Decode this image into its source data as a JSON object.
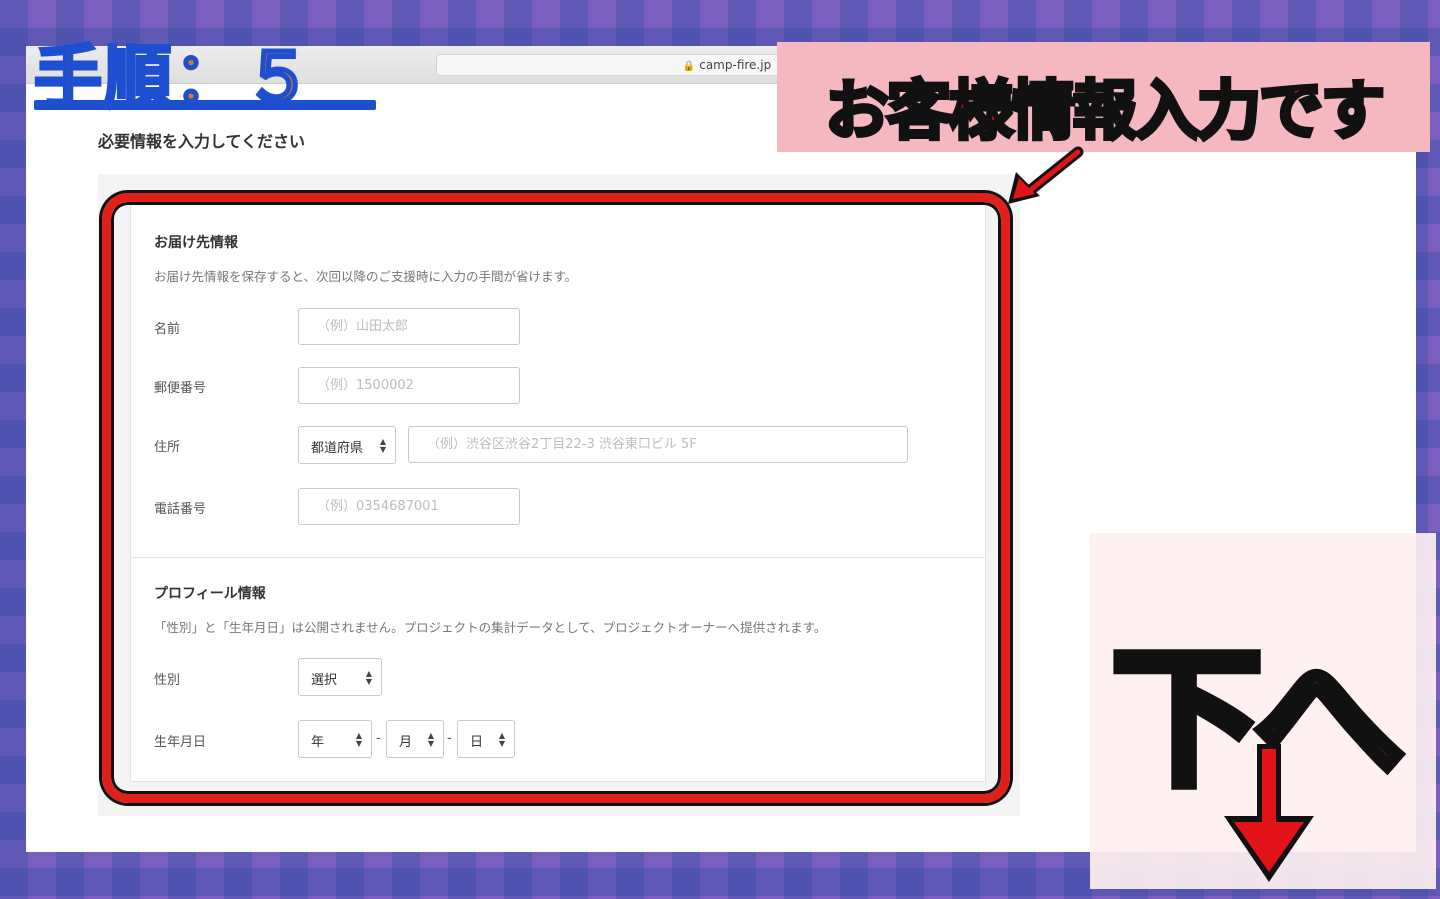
{
  "browser": {
    "url": "camp-fire.jp"
  },
  "page": {
    "heading": "必要情報を入力してください"
  },
  "delivery": {
    "title": "お届け先情報",
    "note": "お届け先情報を保存すると、次回以降のご支援時に入力の手間が省けます。",
    "name_label": "名前",
    "name_placeholder": "（例）山田太郎",
    "postal_label": "郵便番号",
    "postal_placeholder": "（例）1500002",
    "address_label": "住所",
    "prefecture_select": "都道府県",
    "address_placeholder": "（例）渋谷区渋谷2丁目22-3 渋谷東口ビル 5F",
    "phone_label": "電話番号",
    "phone_placeholder": "（例）0354687001"
  },
  "profile": {
    "title": "プロフィール情報",
    "note": "「性別」と「生年月日」は公開されません。プロジェクトの集計データとして、プロジェクトオーナーへ提供されます。",
    "gender_label": "性別",
    "gender_select": "選択",
    "birthdate_label": "生年月日",
    "year_select": "年",
    "month_select": "月",
    "day_select": "日",
    "separator": "-"
  },
  "overlay": {
    "step": "手順：５",
    "banner": "お客様情報入力です",
    "next": "下へ",
    "colors": {
      "accent_red": "#e3131a",
      "step_orange": "#d9781f",
      "step_blue": "#1e4fd0",
      "banner_pink": "#f5b8c0"
    }
  }
}
